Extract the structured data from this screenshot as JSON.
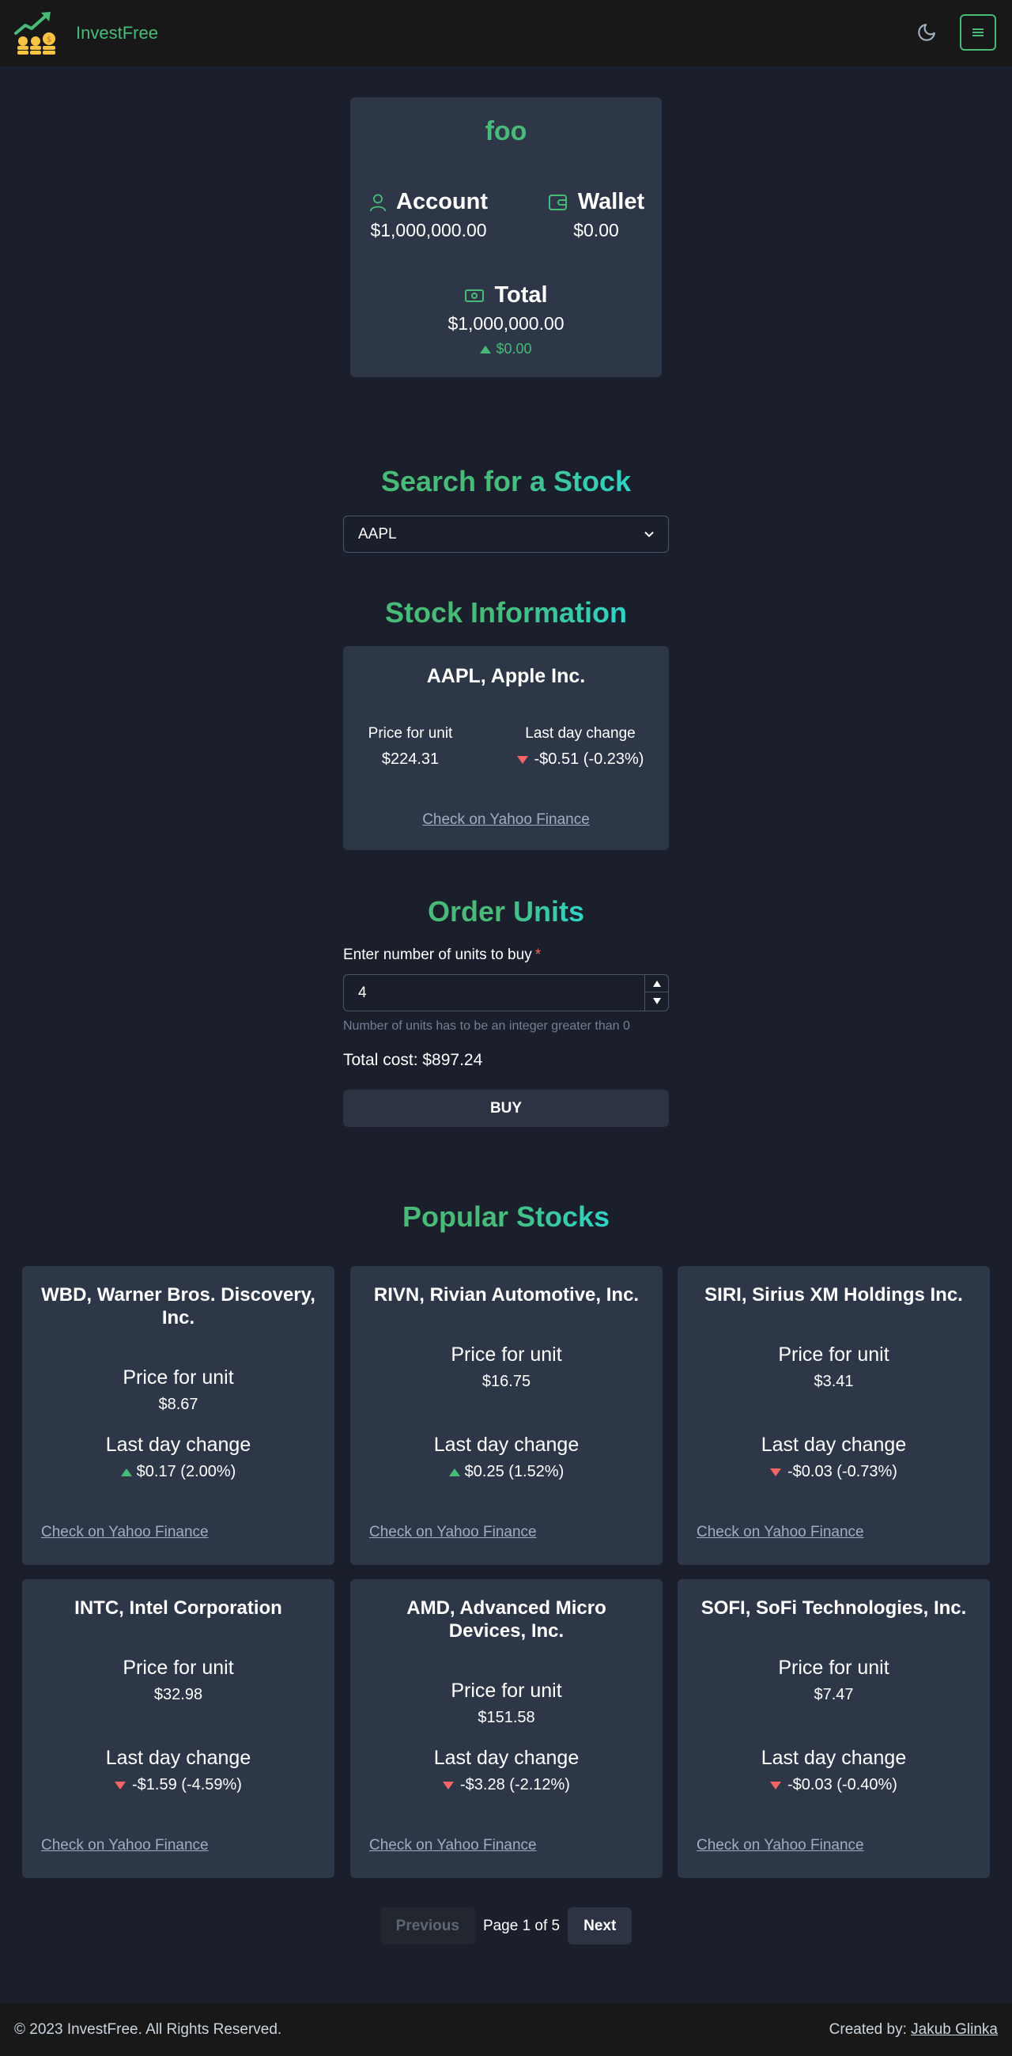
{
  "app": {
    "name": "InvestFree"
  },
  "colors": {
    "accent": "#48bb78",
    "negative": "#f56565",
    "card": "#2d3748",
    "background": "#1b1f2b"
  },
  "header": {
    "theme_icon": "moon-icon",
    "menu_icon": "hamburger-icon"
  },
  "balance": {
    "username": "foo",
    "account_label": "Account",
    "account_value": "$1,000,000.00",
    "wallet_label": "Wallet",
    "wallet_value": "$0.00",
    "total_label": "Total",
    "total_value": "$1,000,000.00",
    "total_change": "$0.00"
  },
  "search": {
    "heading": "Search for a Stock",
    "selected": "AAPL"
  },
  "stock_info": {
    "heading": "Stock Information",
    "name": "AAPL, Apple Inc.",
    "price_label": "Price for unit",
    "price": "$224.31",
    "change_label": "Last day change",
    "change": "-$0.51 (-0.23%)",
    "link": "Check on Yahoo Finance"
  },
  "order": {
    "heading": "Order Units",
    "label": "Enter number of units to buy",
    "required_mark": "*",
    "value": "4",
    "helper": "Number of units has to be an integer greater than 0",
    "total_cost": "Total cost: $897.24",
    "buy_label": "BUY"
  },
  "popular": {
    "heading": "Popular Stocks",
    "price_label": "Price for unit",
    "change_label": "Last day change",
    "link": "Check on Yahoo Finance",
    "stocks": [
      {
        "name": "WBD, Warner Bros. Discovery, Inc.",
        "price": "$8.67",
        "change": "$0.17 (2.00%)",
        "direction": "up"
      },
      {
        "name": "RIVN, Rivian Automotive, Inc.",
        "price": "$16.75",
        "change": "$0.25 (1.52%)",
        "direction": "up"
      },
      {
        "name": "SIRI, Sirius XM Holdings Inc.",
        "price": "$3.41",
        "change": "-$0.03 (-0.73%)",
        "direction": "down"
      },
      {
        "name": "INTC, Intel Corporation",
        "price": "$32.98",
        "change": "-$1.59 (-4.59%)",
        "direction": "down"
      },
      {
        "name": "AMD, Advanced Micro Devices, Inc.",
        "price": "$151.58",
        "change": "-$3.28 (-2.12%)",
        "direction": "down"
      },
      {
        "name": "SOFI, SoFi Technologies, Inc.",
        "price": "$7.47",
        "change": "-$0.03 (-0.40%)",
        "direction": "down"
      }
    ]
  },
  "pagination": {
    "previous": "Previous",
    "page_text": "Page 1 of 5",
    "next": "Next"
  },
  "footer": {
    "copyright": "© 2023 InvestFree. All Rights Reserved.",
    "created_by": "Created by:",
    "author": "Jakub Glinka"
  }
}
